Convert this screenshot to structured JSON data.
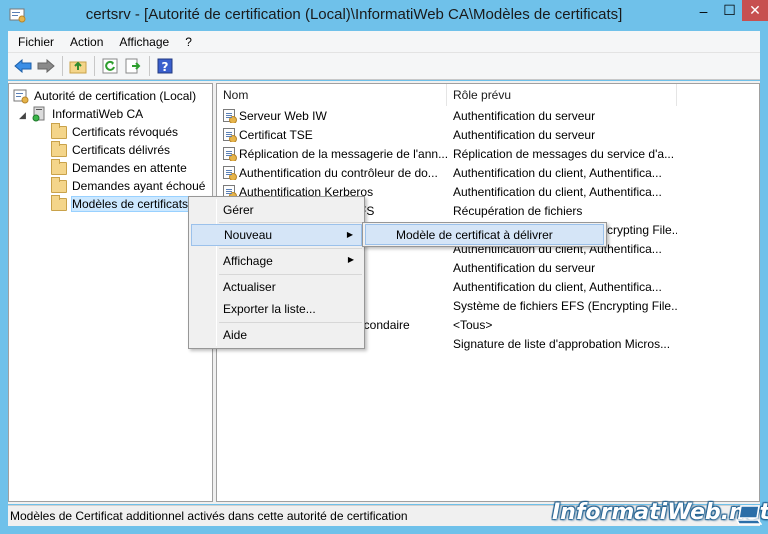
{
  "window": {
    "title": "certsrv - [Autorité de certification (Local)\\InformatiWeb CA\\Modèles de certificats]",
    "minimize_glyph": "–",
    "maximize_glyph": "☐",
    "close_glyph": "✕"
  },
  "menubar": {
    "items": [
      "Fichier",
      "Action",
      "Affichage",
      "?"
    ]
  },
  "toolbar": {
    "icons": [
      "back-arrow-icon",
      "forward-arrow-icon",
      "up-folder-icon",
      "refresh-icon",
      "export-list-icon",
      "help-icon"
    ]
  },
  "tree": {
    "root": "Autorité de certification (Local)",
    "ca": "InformatiWeb CA",
    "items": [
      "Certificats révoqués",
      "Certificats délivrés",
      "Demandes en attente",
      "Demandes ayant échoué",
      "Modèles de certificats"
    ]
  },
  "list": {
    "columns": [
      "Nom",
      "Rôle prévu"
    ],
    "rows": [
      {
        "name": "Serveur Web IW",
        "role": "Authentification du serveur"
      },
      {
        "name": "Certificat TSE",
        "role": "Authentification du serveur"
      },
      {
        "name": "Réplication de la messagerie de l'ann...",
        "role": "Réplication de messages du service d'a..."
      },
      {
        "name": "Authentification du contrôleur de do...",
        "role": "Authentification du client, Authentifica..."
      },
      {
        "name": "Authentification Kerberos",
        "role": "Authentification du client, Authentifica..."
      },
      {
        "name": "EFS",
        "role": "Récupération de fichiers"
      },
      {
        "name": "",
        "role": "crypting File..."
      },
      {
        "name": "",
        "role": "Authentification du client, Authentifica..."
      },
      {
        "name": "",
        "role": "Authentification du serveur"
      },
      {
        "name": "",
        "role": "Authentification du client, Authentifica..."
      },
      {
        "name": "",
        "role": "Système de fichiers EFS (Encrypting File..."
      },
      {
        "name": "secondaire",
        "role": "<Tous>"
      },
      {
        "name": "",
        "role": "Signature de liste d'approbation Micros..."
      }
    ]
  },
  "context_menu": {
    "items": [
      "Gérer",
      "Nouveau",
      "Affichage",
      "Actualiser",
      "Exporter la liste...",
      "Aide"
    ],
    "submenu_arrow": "▶",
    "submenu": {
      "item": "Modèle de certificat à délivrer"
    }
  },
  "statusbar": {
    "text": "Modèles de Certificat additionnel activés dans cette autorité de certification"
  },
  "watermark": {
    "text": "InformatiWeb.net"
  },
  "colors": {
    "window_frame": "#6fc1ea",
    "selection": "#cce8ff",
    "menu_highlight": "#d5e5f7",
    "close_button": "#c75050"
  }
}
